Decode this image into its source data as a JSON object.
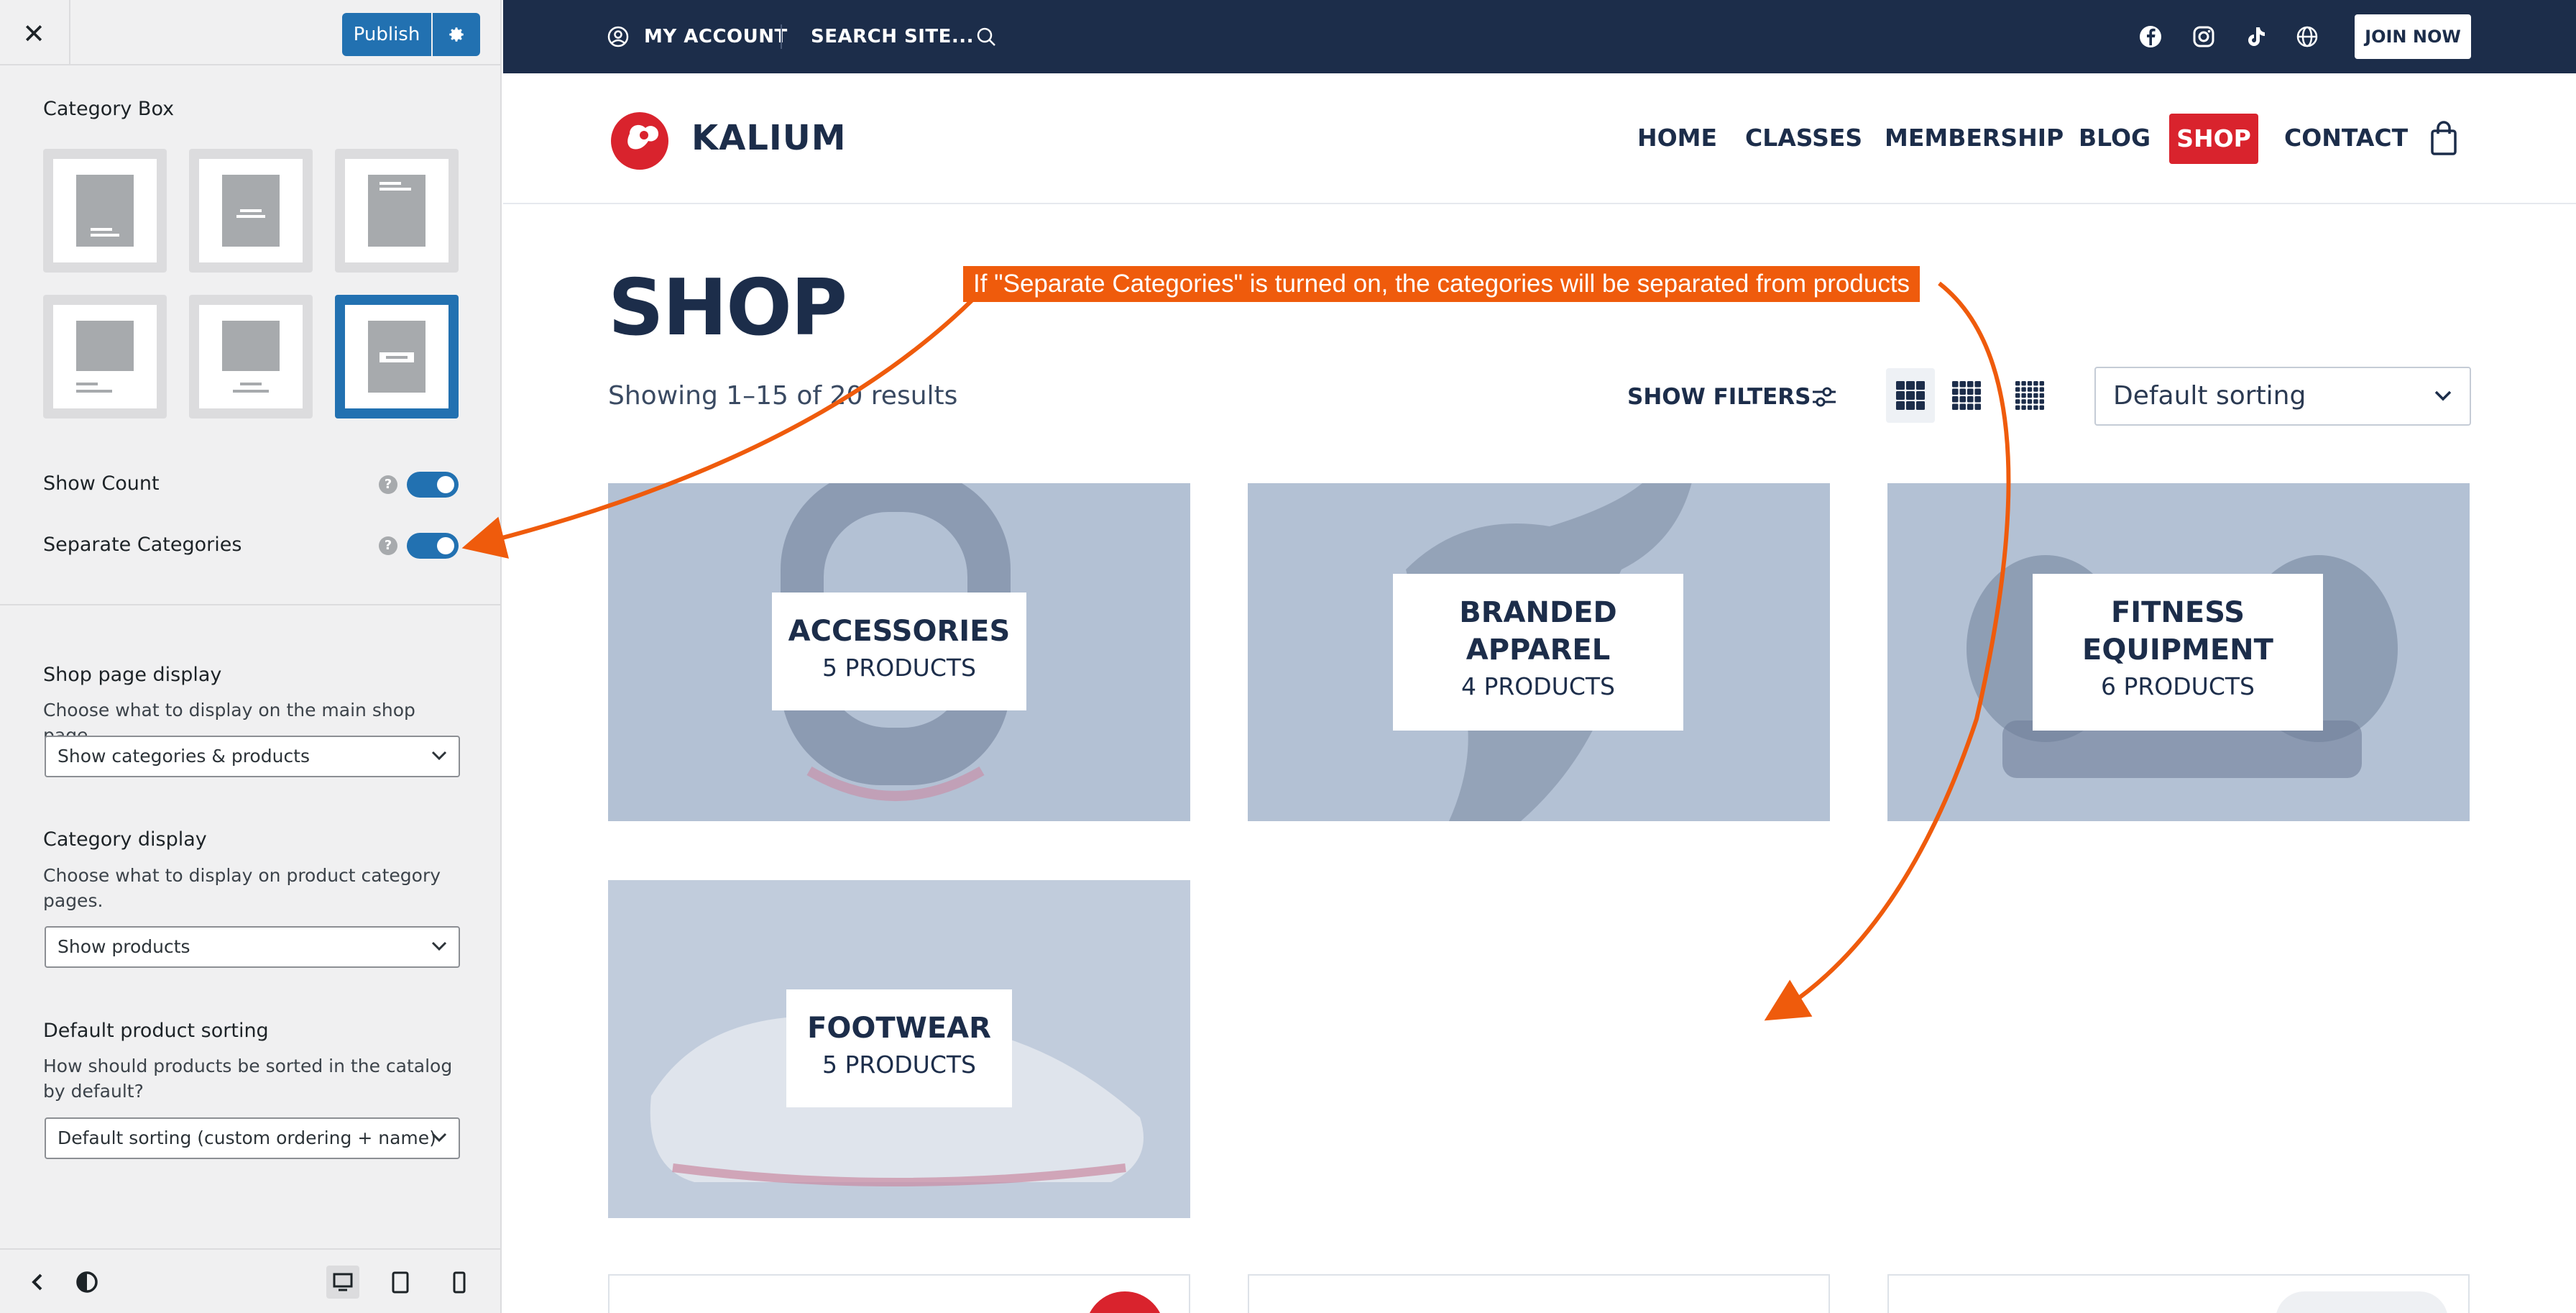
{
  "sidebar": {
    "publish_label": "Publish",
    "section_title": "Category Box",
    "show_count_label": "Show Count",
    "separate_categories_label": "Separate Categories",
    "shop_page_display": {
      "label": "Shop page display",
      "description": "Choose what to display on the main shop page.",
      "value": "Show categories & products"
    },
    "category_display": {
      "label": "Category display",
      "description": "Choose what to display on product category pages.",
      "value": "Show products"
    },
    "default_sorting": {
      "label": "Default product sorting",
      "description": "How should products be sorted in the catalog by default?",
      "value": "Default sorting (custom ordering + name)"
    },
    "help_glyph": "?"
  },
  "topbar": {
    "my_account": "MY ACCOUNT",
    "search": "SEARCH SITE...",
    "join": "JOIN NOW"
  },
  "navbar": {
    "logo": "KALIUM",
    "items": [
      "HOME",
      "CLASSES",
      "MEMBERSHIP",
      "BLOG",
      "SHOP",
      "CONTACT"
    ]
  },
  "shop": {
    "title": "SHOP",
    "results": "Showing 1–15 of 20 results",
    "show_filters": "SHOW FILTERS",
    "sorting": "Default sorting",
    "categories": [
      {
        "name": "ACCESSORIES",
        "count": "5 PRODUCTS"
      },
      {
        "name_line1": "BRANDED",
        "name_line2": "APPAREL",
        "count": "4 PRODUCTS"
      },
      {
        "name_line1": "FITNESS",
        "name_line2": "EQUIPMENT",
        "count": "6 PRODUCTS"
      },
      {
        "name": "FOOTWEAR",
        "count": "5 PRODUCTS"
      }
    ]
  },
  "annotation": "If \"Separate Categories\" is turned on, the categories will be separated from products",
  "colors": {
    "wp_blue": "#2271b1",
    "site_navy": "#1c2d4a",
    "shop_red": "#d9232d",
    "annotation_orange": "#ef5b0c",
    "category_tint": "#b6c3d6"
  },
  "icons": [
    "close-icon",
    "gear-icon",
    "help-icon",
    "user-icon",
    "search-icon",
    "facebook-icon",
    "instagram-icon",
    "tiktok-icon",
    "globe-icon",
    "cart-icon",
    "filters-icon",
    "grid-3-icon",
    "grid-4-icon",
    "grid-5-icon",
    "chevron-down-icon",
    "back-icon",
    "contrast-icon",
    "desktop-icon",
    "tablet-icon",
    "mobile-icon"
  ]
}
